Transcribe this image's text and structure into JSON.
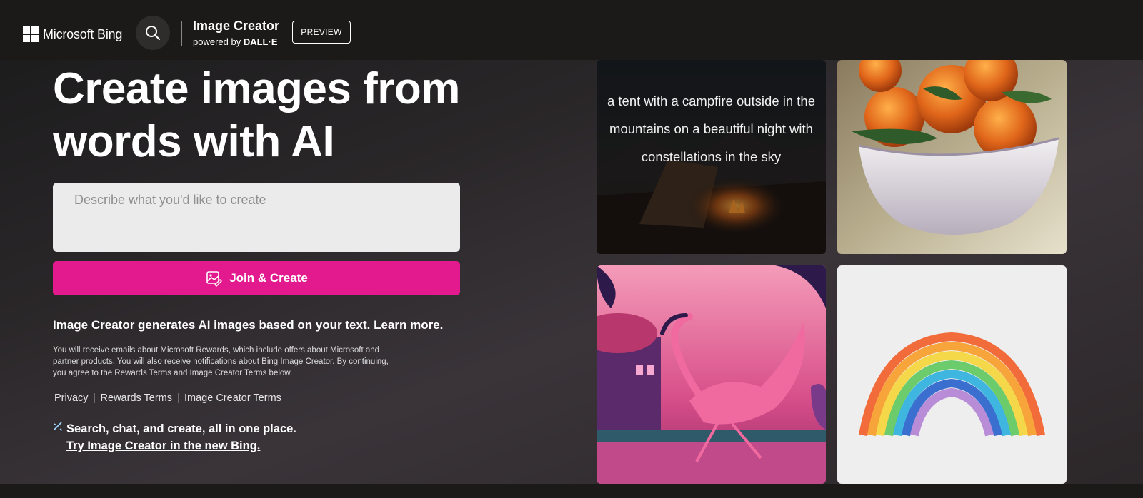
{
  "header": {
    "brand": "Microsoft Bing",
    "product_title": "Image Creator",
    "powered_prefix": "powered by",
    "powered_name": "DALL·E",
    "preview_label": "PREVIEW"
  },
  "hero": {
    "headline": "Create images from words with AI",
    "prompt_placeholder": "Describe what you'd like to create",
    "create_label": "Join & Create"
  },
  "info": {
    "main_text": "Image Creator generates AI images based on your text.",
    "learn_more": "Learn more.",
    "disclaimer": "You will receive emails about Microsoft Rewards, which include offers about Microsoft and partner products. You will also receive notifications about Bing Image Creator. By continuing, you agree to the Rewards Terms and Image Creator Terms below."
  },
  "footer_links": [
    "Privacy",
    "Rewards Terms",
    "Image Creator Terms"
  ],
  "promo": {
    "text": "Search, chat, and create, all in one place.",
    "link": "Try Image Creator in the new Bing."
  },
  "gallery": {
    "tile1_caption": "a tent with a campfire outside in the mountains on a beautiful night with constellations in the sky"
  },
  "colors": {
    "accent": "#e21a8e",
    "topbar": "#1b1a19",
    "input_bg": "#ebebeb"
  }
}
